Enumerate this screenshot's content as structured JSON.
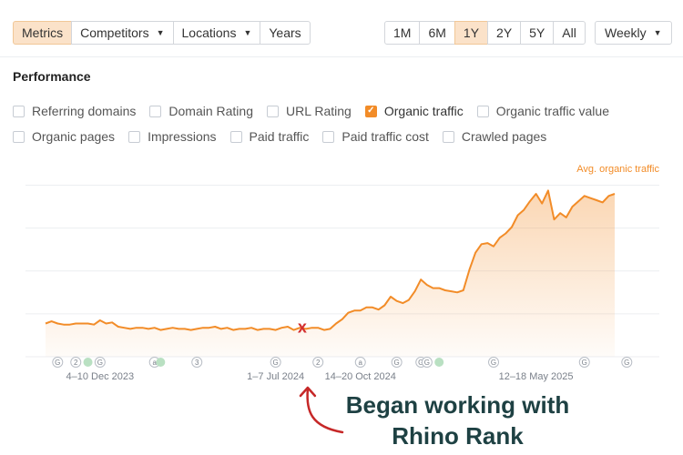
{
  "toolbar": {
    "tabs": [
      {
        "label": "Metrics",
        "active": true,
        "dropdown": false
      },
      {
        "label": "Competitors",
        "active": false,
        "dropdown": true
      },
      {
        "label": "Locations",
        "active": false,
        "dropdown": true
      },
      {
        "label": "Years",
        "active": false,
        "dropdown": false
      }
    ],
    "ranges": [
      {
        "label": "1M",
        "active": false
      },
      {
        "label": "6M",
        "active": false
      },
      {
        "label": "1Y",
        "active": true
      },
      {
        "label": "2Y",
        "active": false
      },
      {
        "label": "5Y",
        "active": false
      },
      {
        "label": "All",
        "active": false
      }
    ],
    "interval": {
      "label": "Weekly"
    }
  },
  "section_title": "Performance",
  "metric_rows": [
    [
      {
        "label": "Referring domains",
        "checked": false
      },
      {
        "label": "Domain Rating",
        "checked": false
      },
      {
        "label": "URL Rating",
        "checked": false
      },
      {
        "label": "Organic traffic",
        "checked": true
      },
      {
        "label": "Organic traffic value",
        "checked": false
      }
    ],
    [
      {
        "label": "Organic pages",
        "checked": false
      },
      {
        "label": "Impressions",
        "checked": false
      },
      {
        "label": "Paid traffic",
        "checked": false
      },
      {
        "label": "Paid traffic cost",
        "checked": false
      },
      {
        "label": "Crawled pages",
        "checked": false
      }
    ]
  ],
  "chart_data": {
    "type": "area",
    "series": [
      {
        "name": "Avg. organic traffic",
        "color": "#f28c28",
        "values": [
          31,
          33,
          31,
          30,
          30,
          31,
          31,
          31,
          30,
          34,
          31,
          32,
          28,
          27,
          26,
          27,
          27,
          26,
          27,
          25,
          26,
          27,
          26,
          26,
          25,
          26,
          27,
          27,
          28,
          26,
          27,
          25,
          26,
          26,
          27,
          25,
          26,
          26,
          25,
          27,
          28,
          25,
          27,
          26,
          27,
          27,
          25,
          26,
          31,
          35,
          41,
          43,
          43,
          46,
          46,
          44,
          48,
          56,
          52,
          50,
          53,
          61,
          72,
          67,
          64,
          64,
          62,
          61,
          60,
          62,
          81,
          97,
          105,
          106,
          103,
          111,
          115,
          121,
          132,
          137,
          145,
          152,
          143,
          155,
          128,
          134,
          130,
          140,
          145,
          150,
          148,
          146,
          144,
          150,
          152
        ]
      }
    ],
    "y_grid_values": [
      0,
      40,
      80,
      120,
      160
    ],
    "ylim": [
      0,
      163
    ],
    "x_tick_labels": [
      {
        "label": "4–10 Dec 2023",
        "index": 9
      },
      {
        "label": "1–7 Jul 2024",
        "index": 38
      },
      {
        "label": "14–20 Oct 2024",
        "index": 52
      },
      {
        "label": "12–18 May 2025",
        "index": 81
      }
    ],
    "event_markers": [
      {
        "label": "G",
        "index": 2,
        "kind": "badge"
      },
      {
        "label": "2",
        "index": 5,
        "kind": "badge"
      },
      {
        "label": "",
        "index": 7,
        "kind": "dot"
      },
      {
        "label": "G",
        "index": 9,
        "kind": "badge"
      },
      {
        "label": "a",
        "index": 18,
        "kind": "badge"
      },
      {
        "label": "",
        "index": 19,
        "kind": "dot"
      },
      {
        "label": "3",
        "index": 25,
        "kind": "badge"
      },
      {
        "label": "G",
        "index": 38,
        "kind": "badge"
      },
      {
        "label": "2",
        "index": 45,
        "kind": "badge"
      },
      {
        "label": "a",
        "index": 52,
        "kind": "badge"
      },
      {
        "label": "G",
        "index": 58,
        "kind": "badge"
      },
      {
        "label": "G",
        "index": 62,
        "kind": "badge"
      },
      {
        "label": "G",
        "index": 63,
        "kind": "badge"
      },
      {
        "label": "",
        "index": 65,
        "kind": "dot"
      },
      {
        "label": "G",
        "index": 74,
        "kind": "badge"
      },
      {
        "label": "G",
        "index": 89,
        "kind": "badge"
      },
      {
        "label": "G",
        "index": 96,
        "kind": "badge"
      }
    ],
    "highlight_marker": {
      "label": "x",
      "index": 43,
      "color": "#d32f2f"
    },
    "grid": true,
    "legend_position": "top-right"
  },
  "annotation": {
    "line1": "Began working with",
    "line2": "Rhino Rank",
    "color": "#1e4143",
    "arrow_color": "#c62828"
  }
}
